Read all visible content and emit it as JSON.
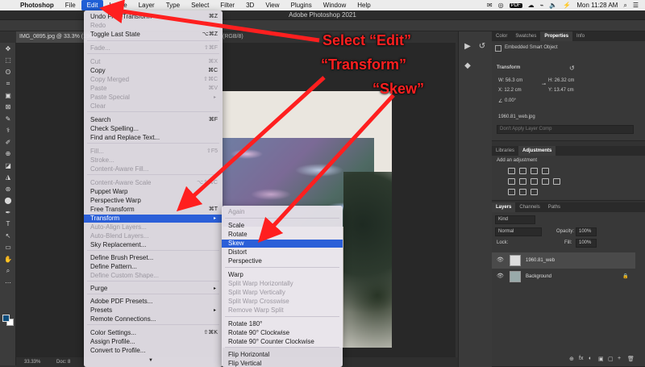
{
  "menubar": {
    "apple": "",
    "app_name": "Photoshop",
    "items": [
      "File",
      "Edit",
      "Image",
      "Layer",
      "Type",
      "Select",
      "Filter",
      "3D",
      "View",
      "Plugins",
      "Window",
      "Help"
    ],
    "active": "Edit",
    "clock": "Mon 11:28 AM",
    "tray": [
      "✉",
      "◎",
      "PDF",
      "☁",
      "⌁",
      "🔈",
      "⚡",
      "⌕",
      "☰"
    ]
  },
  "window": {
    "title": "Adobe Photoshop 2021"
  },
  "document": {
    "tab_label": "IMG_0895.jpg @ 33.3% (1960.81",
    "tab_suffix": "(RGB/8)",
    "zoom": "33.33%",
    "doc_info": "Doc: 8"
  },
  "edit_menu": {
    "items": [
      {
        "label": "Undo Free Transform",
        "shortcut": "⌘Z",
        "disabled": false
      },
      {
        "label": "Redo",
        "shortcut": "",
        "disabled": true
      },
      {
        "label": "Toggle Last State",
        "shortcut": "⌥⌘Z",
        "disabled": false
      },
      {
        "label": "Fade...",
        "shortcut": "⇧⌘F",
        "disabled": true
      },
      {
        "label": "Cut",
        "shortcut": "⌘X",
        "disabled": true
      },
      {
        "label": "Copy",
        "shortcut": "⌘C",
        "disabled": false
      },
      {
        "label": "Copy Merged",
        "shortcut": "⇧⌘C",
        "disabled": true
      },
      {
        "label": "Paste",
        "shortcut": "⌘V",
        "disabled": true
      },
      {
        "label": "Paste Special",
        "shortcut": "▸",
        "disabled": true
      },
      {
        "label": "Clear",
        "shortcut": "",
        "disabled": true
      },
      {
        "label": "Search",
        "shortcut": "⌘F",
        "disabled": false
      },
      {
        "label": "Check Spelling...",
        "shortcut": "",
        "disabled": false
      },
      {
        "label": "Find and Replace Text...",
        "shortcut": "",
        "disabled": false
      },
      {
        "label": "Fill...",
        "shortcut": "⇧F5",
        "disabled": true
      },
      {
        "label": "Stroke...",
        "shortcut": "",
        "disabled": true
      },
      {
        "label": "Content-Aware Fill...",
        "shortcut": "",
        "disabled": true
      },
      {
        "label": "Content-Aware Scale",
        "shortcut": "⌥⇧⌘C",
        "disabled": true
      },
      {
        "label": "Puppet Warp",
        "shortcut": "",
        "disabled": false
      },
      {
        "label": "Perspective Warp",
        "shortcut": "",
        "disabled": false
      },
      {
        "label": "Free Transform",
        "shortcut": "⌘T",
        "disabled": false
      },
      {
        "label": "Transform",
        "shortcut": "▸",
        "disabled": false
      },
      {
        "label": "Auto-Align Layers...",
        "shortcut": "",
        "disabled": true
      },
      {
        "label": "Auto-Blend Layers...",
        "shortcut": "",
        "disabled": true
      },
      {
        "label": "Sky Replacement...",
        "shortcut": "",
        "disabled": false
      },
      {
        "label": "Define Brush Preset...",
        "shortcut": "",
        "disabled": false
      },
      {
        "label": "Define Pattern...",
        "shortcut": "",
        "disabled": false
      },
      {
        "label": "Define Custom Shape...",
        "shortcut": "",
        "disabled": true
      },
      {
        "label": "Purge",
        "shortcut": "▸",
        "disabled": false
      },
      {
        "label": "Adobe PDF Presets...",
        "shortcut": "",
        "disabled": false
      },
      {
        "label": "Presets",
        "shortcut": "▸",
        "disabled": false
      },
      {
        "label": "Remote Connections...",
        "shortcut": "",
        "disabled": false
      },
      {
        "label": "Color Settings...",
        "shortcut": "⇧⌘K",
        "disabled": false
      },
      {
        "label": "Assign Profile...",
        "shortcut": "",
        "disabled": false
      },
      {
        "label": "Convert to Profile...",
        "shortcut": "",
        "disabled": false
      }
    ],
    "more_arrow": "▼"
  },
  "transform_menu": {
    "items": [
      {
        "label": "Again",
        "disabled": true
      },
      {
        "label": "Scale",
        "disabled": false
      },
      {
        "label": "Rotate",
        "disabled": false
      },
      {
        "label": "Skew",
        "disabled": false
      },
      {
        "label": "Distort",
        "disabled": false
      },
      {
        "label": "Perspective",
        "disabled": false
      },
      {
        "label": "Warp",
        "disabled": false
      },
      {
        "label": "Split Warp Horizontally",
        "disabled": true
      },
      {
        "label": "Split Warp Vertically",
        "disabled": true
      },
      {
        "label": "Split Warp Crosswise",
        "disabled": true
      },
      {
        "label": "Remove Warp Split",
        "disabled": true
      },
      {
        "label": "Rotate 180°",
        "disabled": false
      },
      {
        "label": "Rotate 90° Clockwise",
        "disabled": false
      },
      {
        "label": "Rotate 90° Counter Clockwise",
        "disabled": false
      },
      {
        "label": "Flip Horizontal",
        "disabled": false
      },
      {
        "label": "Flip Vertical",
        "disabled": false
      }
    ]
  },
  "annotation": {
    "line1": "Select “Edit”",
    "line2": "“Transform”",
    "line3": "“Skew”",
    "color": "#ff1f1f"
  },
  "properties": {
    "tabs": [
      "Color",
      "Swatches",
      "Properties",
      "Info"
    ],
    "active_tab": "Properties",
    "object_type": "Embedded Smart Object",
    "section": "Transform",
    "w": "W:  56.3 cm",
    "h": "H:  26.32 cm",
    "x": "X:  12.2 cm",
    "y": "Y:  13.47 cm",
    "angle": "0.00°",
    "filename": "1960.81_web.jpg",
    "comp_placeholder": "Don't Apply Layer Comp"
  },
  "adjustments": {
    "tabs": [
      "Libraries",
      "Adjustments"
    ],
    "active_tab": "Adjustments",
    "hint": "Add an adjustment"
  },
  "layers": {
    "tabs": [
      "Layers",
      "Channels",
      "Paths"
    ],
    "active_tab": "Layers",
    "filter": "Kind",
    "blend_mode": "Normal",
    "opacity_label": "Opacity:",
    "opacity": "100%",
    "lock_label": "Lock:",
    "fill_label": "Fill:",
    "fill": "100%",
    "items": [
      {
        "name": "1960.81_web"
      },
      {
        "name": "Background"
      }
    ],
    "footer_icons": [
      "⊕",
      "fx",
      "◐",
      "▣",
      "▢",
      "+",
      "🗑"
    ]
  },
  "toolbar": {
    "tools": [
      "✥",
      "⬚",
      "ʘ",
      "⌗",
      "▣",
      "⊠",
      "✎",
      "⚕",
      "✐",
      "⊕",
      "◪",
      "◮",
      "⊛",
      "⬤",
      "✒",
      "T",
      "↖",
      "▭",
      "✋",
      "⌕",
      "⋯"
    ]
  },
  "dock": [
    "▶",
    "↺",
    "◆",
    "▦"
  ]
}
